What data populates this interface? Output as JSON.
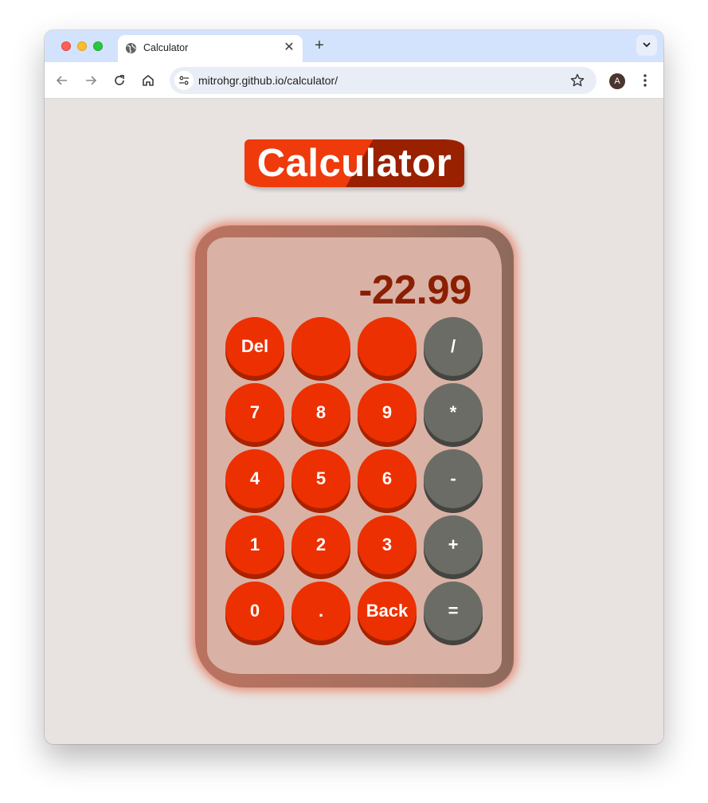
{
  "browser": {
    "tab_title": "Calculator",
    "new_tab_symbol": "+",
    "url": "mitrohgr.github.io/calculator/",
    "avatar_initial": "A"
  },
  "page": {
    "logo_text": "Calculator",
    "display_value": "-22.99",
    "colors": {
      "accent_red": "#ed3001",
      "dark_red": "#992100",
      "operator_gray": "#6c6c66",
      "display_text": "#8b1f02",
      "background": "#e8e3e0"
    },
    "keys": [
      [
        "Del",
        "",
        "",
        "/"
      ],
      [
        "7",
        "8",
        "9",
        "*"
      ],
      [
        "4",
        "5",
        "6",
        "-"
      ],
      [
        "1",
        "2",
        "3",
        "+"
      ],
      [
        "0",
        ".",
        "Back",
        "="
      ]
    ]
  }
}
